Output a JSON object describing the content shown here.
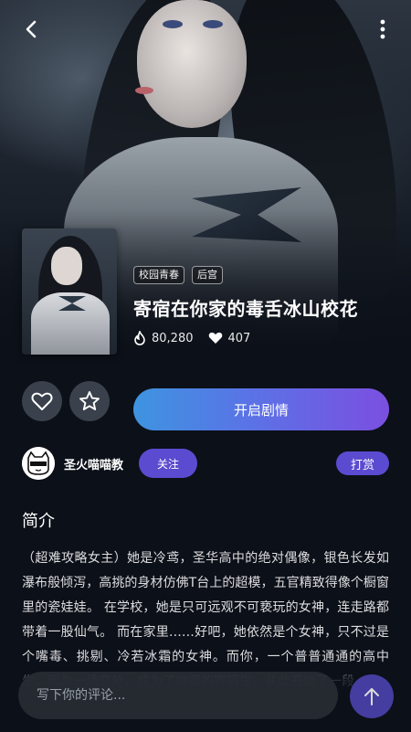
{
  "header": {
    "back_icon": "chevron-left-icon",
    "more_icon": "vertical-dots-icon"
  },
  "book": {
    "tags": [
      "校园青春",
      "后宫"
    ],
    "title": "寄宿在你家的毒舌冰山校花",
    "heat": "80,280",
    "likes": "407"
  },
  "actions": {
    "favorite_icon": "heart-outline-icon",
    "collect_icon": "star-outline-icon",
    "start_label": "开启剧情"
  },
  "author": {
    "name": "圣火喵喵教",
    "follow_label": "关注",
    "tip_label": "打赏"
  },
  "intro": {
    "heading": "简介",
    "text": "（超难攻略女主）她是冷鸢，圣华高中的绝对偶像，银色长发如瀑布般倾泻，高挑的身材仿佛T台上的超模，五官精致得像个橱窗里的瓷娃娃。 在学校，她是只可远观不可亵玩的女神，连走路都带着一股仙气。 而在家里……好吧，她依然是个女神，只不过是个嘴毒、挑剔、冷若冰霜的女神。而你，一个普普通通的高中生，因为一场意外，成为了她家的寄宿生，从此开始了一段"
  },
  "comment": {
    "placeholder": "写下你的评论..."
  },
  "colors": {
    "background": "#0c1018",
    "accent": "#5b4bd0",
    "start_gradient": [
      "#3e94e0",
      "#7b4fe0"
    ]
  }
}
